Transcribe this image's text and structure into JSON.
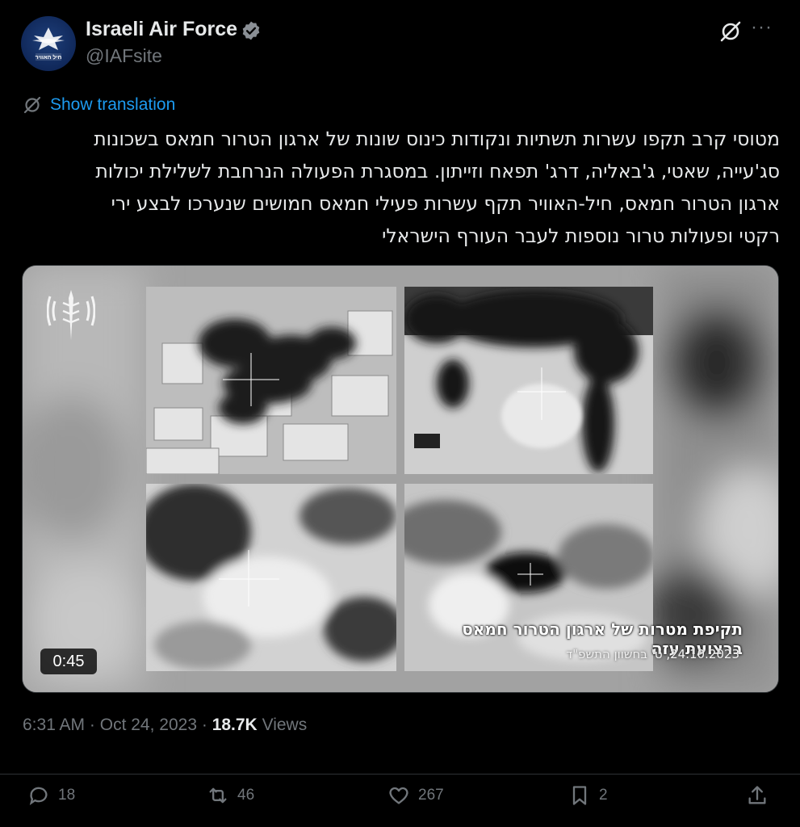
{
  "author": {
    "display_name": "Israeli Air Force",
    "handle": "@IAFsite",
    "avatar_text": "חיל האוויר"
  },
  "show_translation": "Show translation",
  "tweet_lines": [
    "מטוסי קרב תקפו עשרות תשתיות ונקודות כינוס שונות של ארגון הטרור חמאס בשכונות",
    "סג'עייה, שאטי, ג'באליה, דרג' תפאח וזייתון. במסגרת הפעולה הנרחבת לשלילת יכולות",
    "ארגון הטרור חמאס, חיל-האוויר תקף עשרות פעילי חמאס חמושים שנערכו לבצע ירי",
    "רקטי ופעולות טרור נוספות לעבר העורף הישראלי"
  ],
  "video": {
    "duration": "0:45",
    "caption": "תקיפת מטרות של ארגון הטרור חמאס ברצועת עזה",
    "date": "24.10.2023, ט' בחשוון התשפ\"ד"
  },
  "meta": {
    "time": "6:31 AM",
    "date": "Oct 24, 2023",
    "separator": "·",
    "views_count": "18.7K",
    "views_label": "Views"
  },
  "actions": {
    "replies": "18",
    "reposts": "46",
    "likes": "267",
    "bookmarks": "2"
  },
  "icons": [
    "verified-icon",
    "grok-icon",
    "more-icon",
    "translate-icon",
    "reply-icon",
    "repost-icon",
    "like-icon",
    "bookmark-icon",
    "share-icon"
  ],
  "colors": {
    "accent": "#1d9bf0",
    "muted": "#71767b",
    "text": "#e7e9ea",
    "background": "#000000"
  }
}
